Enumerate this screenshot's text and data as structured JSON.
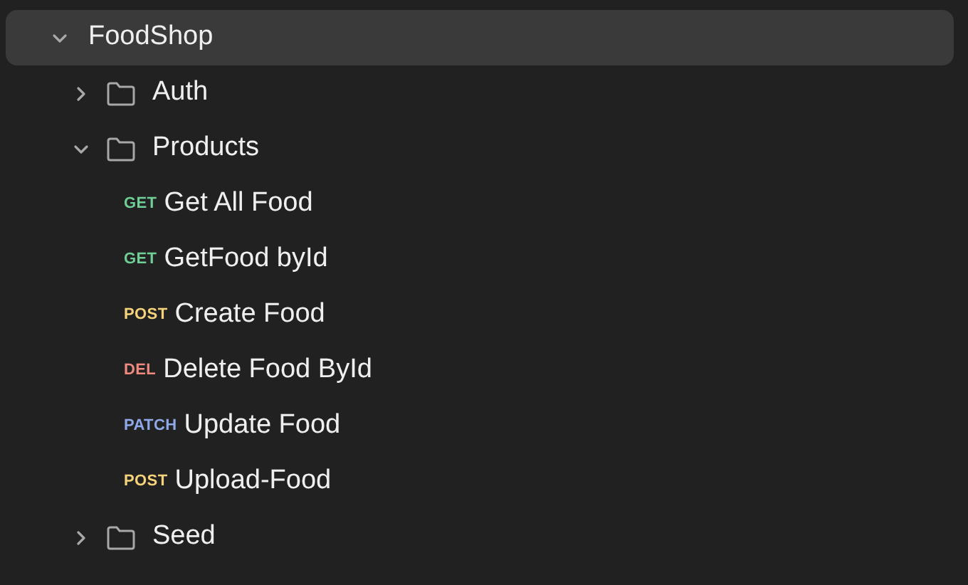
{
  "collection": {
    "name": "FoodShop",
    "kind": "collection",
    "expanded": true,
    "selected": true,
    "children": [
      {
        "kind": "folder",
        "name": "Auth",
        "expanded": false,
        "selected": false
      },
      {
        "kind": "folder",
        "name": "Products",
        "expanded": true,
        "selected": false,
        "children": [
          {
            "kind": "request",
            "method": "GET",
            "color": "#6fcf97",
            "name": "Get All Food",
            "selected": false
          },
          {
            "kind": "request",
            "method": "GET",
            "color": "#6fcf97",
            "name": "GetFood byId",
            "selected": false
          },
          {
            "kind": "request",
            "method": "POST",
            "color": "#f5d37a",
            "name": "Create Food",
            "selected": false
          },
          {
            "kind": "request",
            "method": "DEL",
            "color": "#f08a7e",
            "name": "Delete Food ById",
            "selected": false
          },
          {
            "kind": "request",
            "method": "PATCH",
            "color": "#8fa8e8",
            "name": "Update Food",
            "selected": false
          },
          {
            "kind": "request",
            "method": "POST",
            "color": "#f5d37a",
            "name": "Upload-Food",
            "selected": false
          }
        ]
      },
      {
        "kind": "folder",
        "name": "Seed",
        "expanded": false,
        "selected": false
      }
    ]
  }
}
